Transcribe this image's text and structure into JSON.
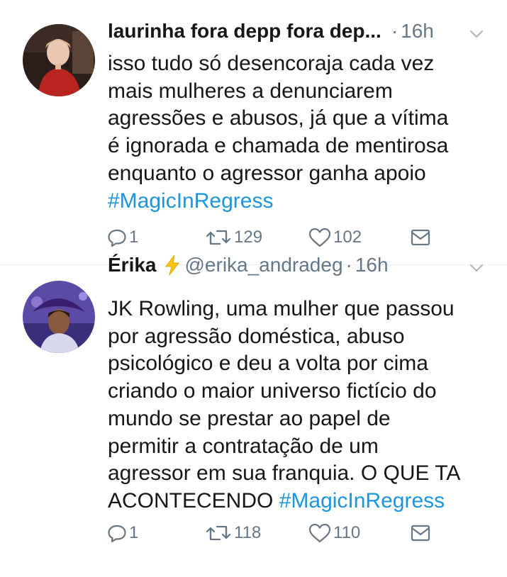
{
  "tweets": [
    {
      "display_name": "laurinha fora depp fora dep...",
      "handle": "",
      "time": "16h",
      "text_lines": [
        "isso tudo só desencoraja cada vez",
        "mais mulheres a denunciarem",
        "agressões e abusos, já que a vítima",
        "é ignorada e chamada de mentirosa",
        "enquanto o agressor ganha apoio"
      ],
      "hashtag": "#MagicInRegress",
      "replies": "1",
      "retweets": "129",
      "likes": "102",
      "icons": {
        "reply": "reply-icon",
        "retweet": "retweet-icon",
        "like": "heart-icon",
        "dm": "envelope-icon",
        "menu": "chevron-down-icon"
      }
    },
    {
      "display_name": "Érika",
      "name_emoji": "lightning-emoji",
      "handle": "@erika_andradeg",
      "time": "16h",
      "text_lines": [
        "JK Rowling, uma mulher que passou",
        "por agressão doméstica, abuso",
        "psicológico e deu a volta por cima",
        "criando o maior universo fictício do",
        "mundo se prestar ao papel de",
        "permitir a contratação de um",
        "agressor em sua franquia. O QUE TA",
        "ACONTECENDO"
      ],
      "hashtag": "#MagicInRegress",
      "replies": "1",
      "retweets": "118",
      "likes": "110",
      "icons": {
        "reply": "reply-icon",
        "retweet": "retweet-icon",
        "like": "heart-icon",
        "dm": "envelope-icon",
        "menu": "chevron-down-icon"
      }
    }
  ],
  "colors": {
    "text": "#14171a",
    "muted": "#657786",
    "link": "#1b95e0",
    "divider": "#e6ecf0"
  }
}
